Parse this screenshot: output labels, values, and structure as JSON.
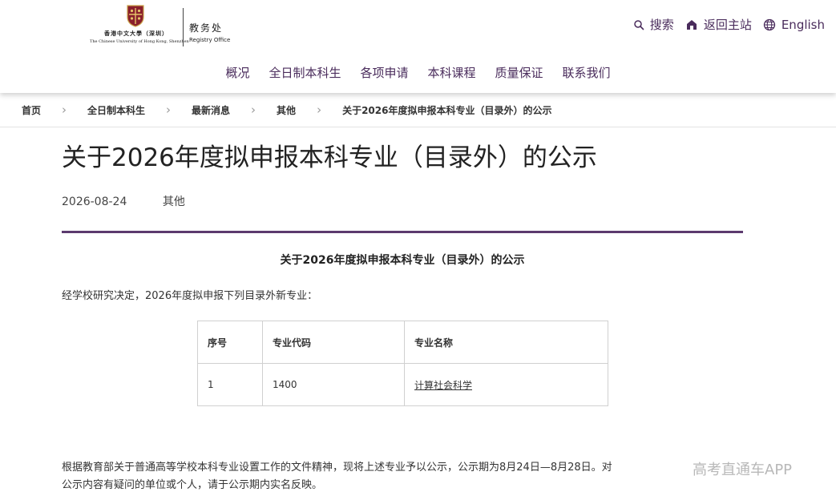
{
  "header": {
    "logo_cn": "香港中文大學（深圳）",
    "logo_en": "The Chinese University of Hong Kong, Shenzhen",
    "office_cn": "教务处",
    "office_en": "Registry Office",
    "search": "搜索",
    "home": "返回主站",
    "language": "English"
  },
  "nav": [
    "概况",
    "全日制本科生",
    "各项申请",
    "本科课程",
    "质量保证",
    "联系我们"
  ],
  "breadcrumb": [
    "首页",
    "全日制本科生",
    "最新消息",
    "其他",
    "关于2026年度拟申报本科专业（目录外）的公示"
  ],
  "article": {
    "title": "关于2026年度拟申报本科专业（目录外）的公示",
    "date": "2026-08-24",
    "category": "其他",
    "subheading": "关于2026年度拟申报本科专业（目录外）的公示",
    "intro": "经学校研究决定，2026年度拟申报下列目录外新专业：",
    "table": {
      "headers": [
        "序号",
        "专业代码",
        "专业名称"
      ],
      "rows": [
        [
          "1",
          "1400",
          "计算社会科学"
        ]
      ]
    },
    "para_line1": "根据教育部关于普通高等学校本科专业设置工作的文件精神，现将上述专业予以公示，公示期为8月24日—8月28日。对",
    "para_line2": "公示内容有疑问的单位或个人，请于公示期内实名反映。"
  },
  "watermark": "高考直通车APP",
  "colors": {
    "accent": "#5c3a6e",
    "nav_text": "#4a2c5c"
  },
  "icons": [
    "crest-icon",
    "search-icon",
    "home-icon",
    "globe-icon",
    "chevron-right-icon"
  ]
}
